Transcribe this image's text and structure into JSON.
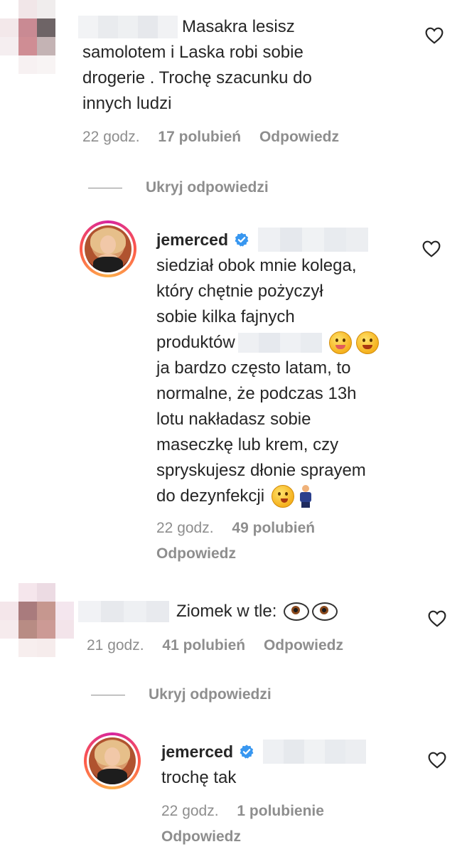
{
  "comments": [
    {
      "text": "Masakra lesisz\nsamolotem i Laska robi sobie\ndrogerie . Trochę szacunku do\ninnych ludzi",
      "time": "22 godz.",
      "likes": "17 polubień",
      "reply_label": "Odpowiedz",
      "hide_replies_label": "Ukryj odpowiedzi",
      "reply": {
        "username": "jemerced",
        "text_lines": [
          "siedział obok mnie kolega,",
          "który chętnie pożyczył",
          "sobie kilka fajnych",
          "produktów",
          "ja bardzo często latam, to",
          "normalne, że podczas 13h",
          "lotu nakładasz sobie",
          "maseczkę lub krem, czy",
          "spryskujesz dłonie sprayem",
          "do dezynfekcji"
        ],
        "time": "22 godz.",
        "likes": "49 polubień",
        "reply_label": "Odpowiedz"
      }
    },
    {
      "text": "Ziomek w tle:",
      "time": "21 godz.",
      "likes": "41 polubień",
      "reply_label": "Odpowiedz",
      "hide_replies_label": "Ukryj odpowiedzi",
      "reply": {
        "username": "jemerced",
        "text": "trochę tak",
        "time": "22 godz.",
        "likes": "1 polubienie",
        "reply_label": "Odpowiedz"
      }
    }
  ],
  "icons": {
    "like": "heart-outline-icon",
    "verified": "verified-badge-icon"
  },
  "colors": {
    "text": "#262626",
    "meta": "#8e8e8e",
    "verified": "#3897f0"
  }
}
